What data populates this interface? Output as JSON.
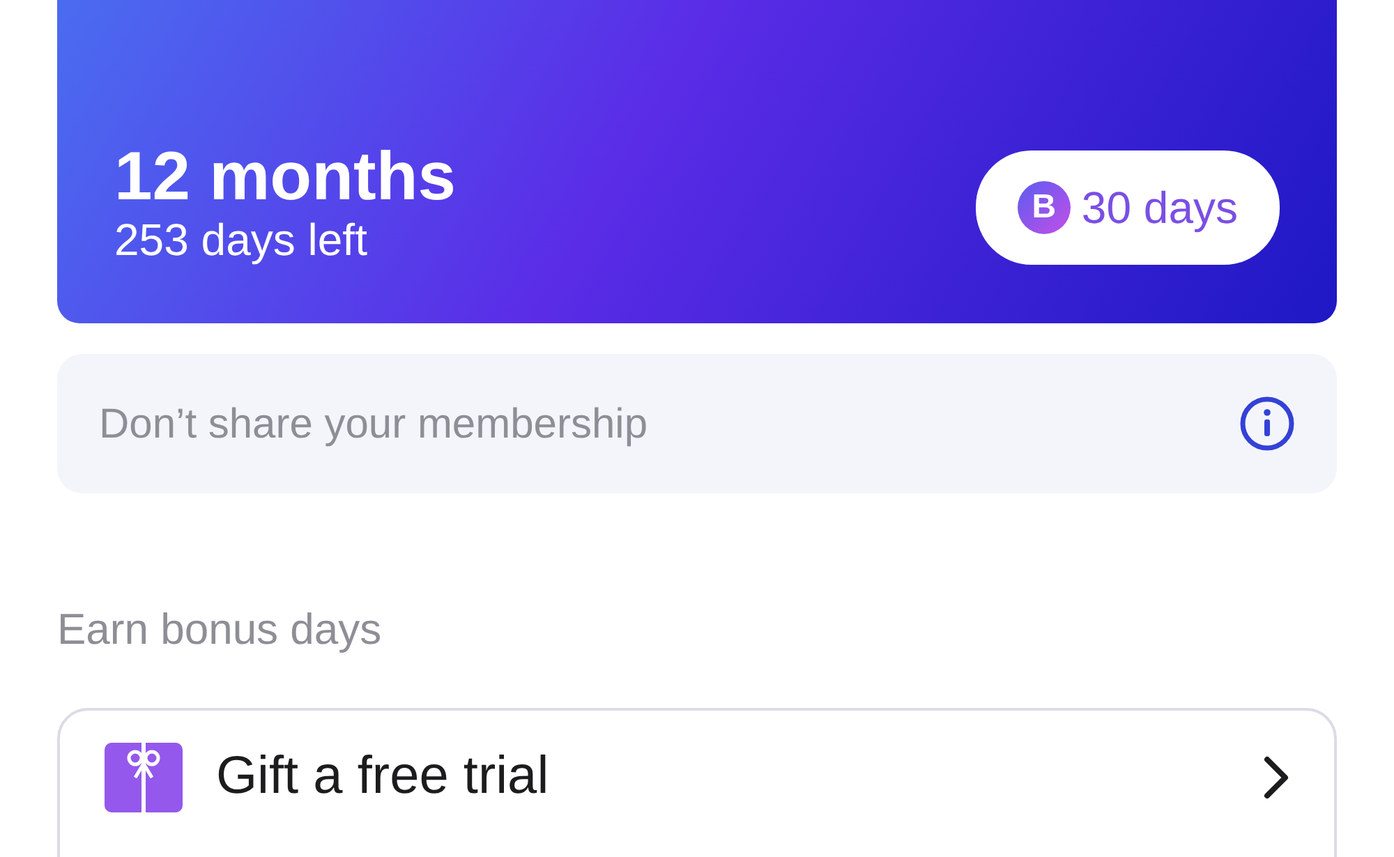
{
  "plan": {
    "title": "12 months",
    "subtitle": "253 days left",
    "bonus_badge": {
      "letter": "B",
      "text": "30 days"
    }
  },
  "notice": {
    "text": "Don’t share your membership"
  },
  "section_title": "Earn bonus days",
  "actions": [
    {
      "label": "Gift a free trial"
    }
  ]
}
